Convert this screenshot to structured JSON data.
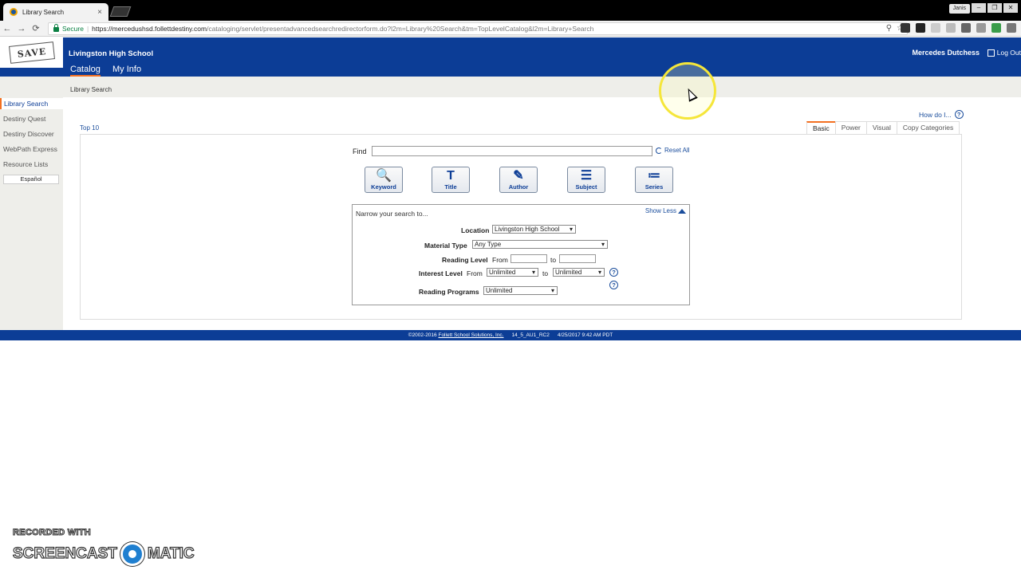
{
  "browser": {
    "tab_title": "Library Search",
    "tab_close": "×",
    "user_badge": "Janis",
    "window_buttons": [
      "–",
      "❐",
      "✕"
    ],
    "nav_back": "←",
    "nav_forward": "→",
    "nav_reload": "⟳",
    "secure_label": "Secure",
    "url_host": "https://mercedushsd.follettdestiny.com",
    "url_path": "/cataloging/servlet/presentadvancedsearchredirectorform.do?l2m=Library%20Search&tm=TopLevelCatalog&l2m=Library+Search"
  },
  "header": {
    "school_name": "Livingston High School",
    "logo_text": "SAVE",
    "nav": [
      "Catalog",
      "My Info"
    ],
    "user_name": "Mercedes Dutchess",
    "logout_label": "Log Out"
  },
  "breadcrumb": "Library Search",
  "sidebar": {
    "items": [
      "Library Search",
      "Destiny Quest",
      "Destiny Discover",
      "WebPath Express",
      "Resource Lists"
    ],
    "language_button": "Español"
  },
  "main": {
    "how_do_i": "How do I...",
    "help_glyph": "?",
    "top10": "Top 10",
    "mode_tabs": [
      "Basic",
      "Power",
      "Visual",
      "Copy Categories"
    ],
    "find_label": "Find",
    "find_value": "",
    "reset_label": "Reset All",
    "search_buttons": [
      {
        "label": "Keyword",
        "glyph": "🔍"
      },
      {
        "label": "Title",
        "glyph": "T"
      },
      {
        "label": "Author",
        "glyph": "✎"
      },
      {
        "label": "Subject",
        "glyph": "☰"
      },
      {
        "label": "Series",
        "glyph": "≔"
      }
    ],
    "narrow": {
      "title": "Narrow your search to...",
      "show_less": "Show Less",
      "location_label": "Location",
      "location_value": "Livingston High School",
      "material_label": "Material Type",
      "material_value": "Any Type",
      "reading_level_label": "Reading Level",
      "from_label": "From",
      "to_label": "to",
      "interest_label": "Interest Level",
      "interest_from": "Unlimited",
      "interest_to": "Unlimited",
      "programs_label": "Reading Programs",
      "programs_value": "Unlimited"
    }
  },
  "footer": {
    "copyright": "©2002-2016",
    "company": "Follett School Solutions, Inc.",
    "version": "14_5_AU1_RC2",
    "timestamp": "4/25/2017 9:42 AM PDT"
  },
  "watermark": {
    "line1": "RECORDED WITH",
    "brand_left": "SCREENCAST",
    "brand_right": "MATIC"
  },
  "colors": {
    "header_blue": "#0c3d96",
    "accent_orange": "#f37021",
    "link_blue": "#1a4d9c",
    "highlight_yellow": "#f5e63a"
  }
}
